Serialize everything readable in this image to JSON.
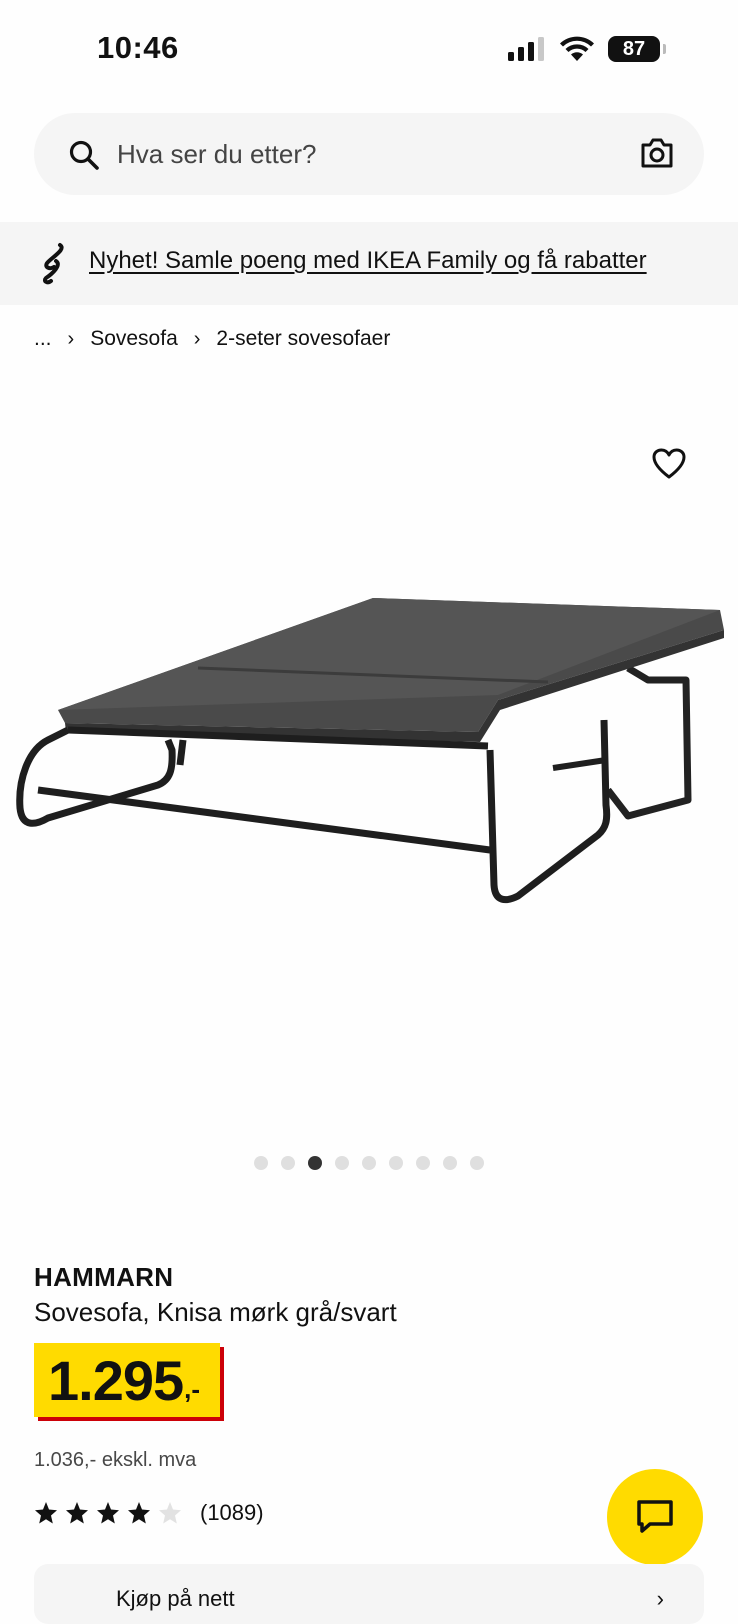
{
  "status_bar": {
    "time": "10:46",
    "battery": "87",
    "icons": [
      "signal-icon",
      "wifi-icon",
      "battery-icon"
    ]
  },
  "search": {
    "placeholder": "Hva ser du etter?",
    "icons": [
      "search-icon",
      "camera-icon"
    ]
  },
  "promo": {
    "text": "Nyhet! Samle poeng med IKEA Family og få rabatter",
    "icon": "ikea-family-icon"
  },
  "breadcrumb": {
    "ellipsis": "...",
    "items": [
      "Sovesofa",
      "2-seter sovesofaer"
    ]
  },
  "gallery": {
    "image_count": 9,
    "active_index": 2,
    "icons": [
      "heart-icon"
    ]
  },
  "product": {
    "brand": "HAMMARN",
    "description": "Sovesofa, Knisa mørk grå/svart",
    "price_integer": "1.295",
    "price_decimal": ",-",
    "price_ex_vat": "1.036,- ekskl. mva",
    "rating": 4,
    "rating_max": 5,
    "review_count": "(1089)"
  },
  "bottom_card": {
    "text": "Kjøp på nett",
    "icon": "chevron-right-icon"
  },
  "colors": {
    "accent_yellow": "#ffdb00",
    "price_shadow_red": "#cc0008",
    "surface_gray": "#f5f5f5"
  }
}
